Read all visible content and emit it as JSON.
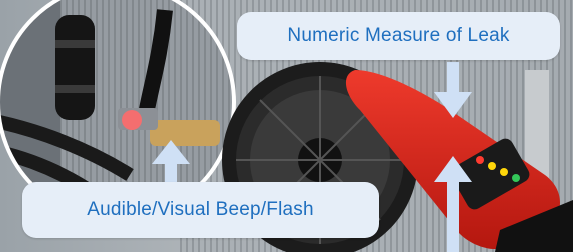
{
  "annotations": {
    "numeric_measure_label": "Numeric Measure of Leak",
    "audible_visual_label": "Audible/Visual Beep/Flash"
  },
  "colors": {
    "label_text": "#1f6fbf",
    "label_box": "#e6eef8",
    "arrow": "#cfe0f5",
    "detector_red": "#d8231b"
  },
  "icons": [
    "arrow-up-icon",
    "arrow-down-icon"
  ]
}
